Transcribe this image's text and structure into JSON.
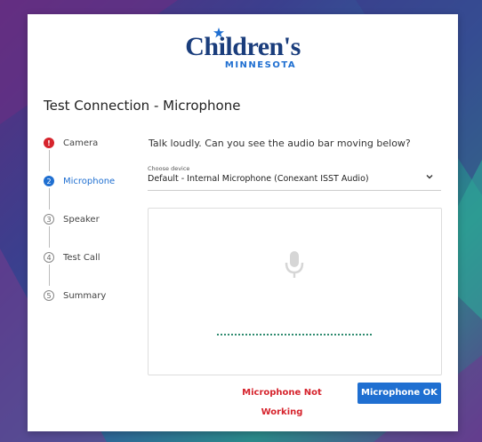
{
  "brand": {
    "name": "Children's",
    "sub": "MINNESOTA",
    "primary_color": "#1a3d7c",
    "accent_color": "#1f6fd1"
  },
  "page": {
    "title": "Test Connection - Microphone",
    "instruction": "Talk loudly. Can you see the audio bar moving below?"
  },
  "steps": [
    {
      "number": "!",
      "label": "Camera",
      "state": "error",
      "icon": "error-icon"
    },
    {
      "number": "2",
      "label": "Microphone",
      "state": "active"
    },
    {
      "number": "3",
      "label": "Speaker",
      "state": "pending"
    },
    {
      "number": "4",
      "label": "Test Call",
      "state": "pending"
    },
    {
      "number": "5",
      "label": "Summary",
      "state": "pending"
    }
  ],
  "device": {
    "caption": "Choose device",
    "value": "Default - Internal Microphone (Conexant ISST Audio)",
    "icon": "chevron-down-icon"
  },
  "meter": {
    "icon": "microphone-icon",
    "bar_color": "#2e8b6f"
  },
  "actions": {
    "not_working_label": "Microphone Not Working",
    "ok_label": "Microphone OK",
    "error_color": "#d6242d"
  }
}
